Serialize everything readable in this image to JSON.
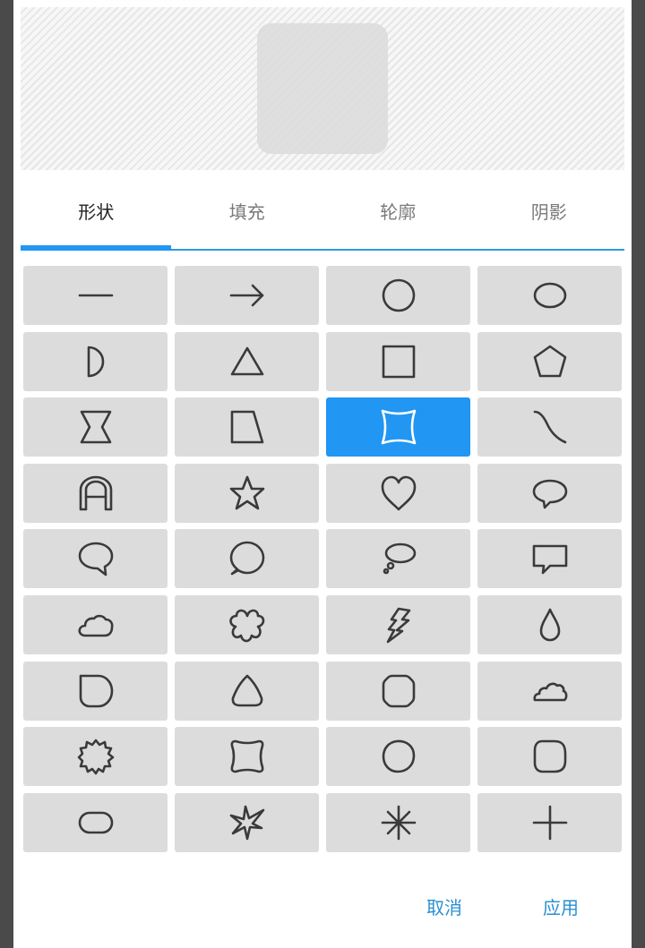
{
  "tabs": [
    {
      "label": "形状",
      "active": true
    },
    {
      "label": "填充",
      "active": false
    },
    {
      "label": "轮廓",
      "active": false
    },
    {
      "label": "阴影",
      "active": false
    }
  ],
  "shapes": [
    "line-icon",
    "arrow-icon",
    "circle-icon",
    "ellipse-icon",
    "half-circle-icon",
    "triangle-icon",
    "square-icon",
    "pentagon-icon",
    "hourglass-icon",
    "trapezoid-icon",
    "concave-square-icon",
    "s-curve-icon",
    "arch-icon",
    "star-icon",
    "heart-icon",
    "oval-speech-bubble-icon",
    "speech-bubble-icon",
    "round-speech-bubble-icon",
    "thought-bubble-icon",
    "rectangular-speech-bubble-icon",
    "cloud-icon",
    "flower-icon",
    "lightning-icon",
    "droplet-icon",
    "rounded-square-tab-icon",
    "reuleaux-triangle-icon",
    "octagon-icon",
    "cloud-outline-icon",
    "starburst-icon",
    "scalloped-square-icon",
    "circle-blob-icon",
    "rounded-blob-icon",
    "rounded-rectangle-icon",
    "explosion-icon",
    "asterisk-icon",
    "plus-icon"
  ],
  "selected_index": 10,
  "colors": {
    "accent": "#2196f3",
    "action_text": "#2a8fd3",
    "cell_background": "#dcdcdc"
  },
  "actions": {
    "cancel_label": "取消",
    "apply_label": "应用"
  }
}
